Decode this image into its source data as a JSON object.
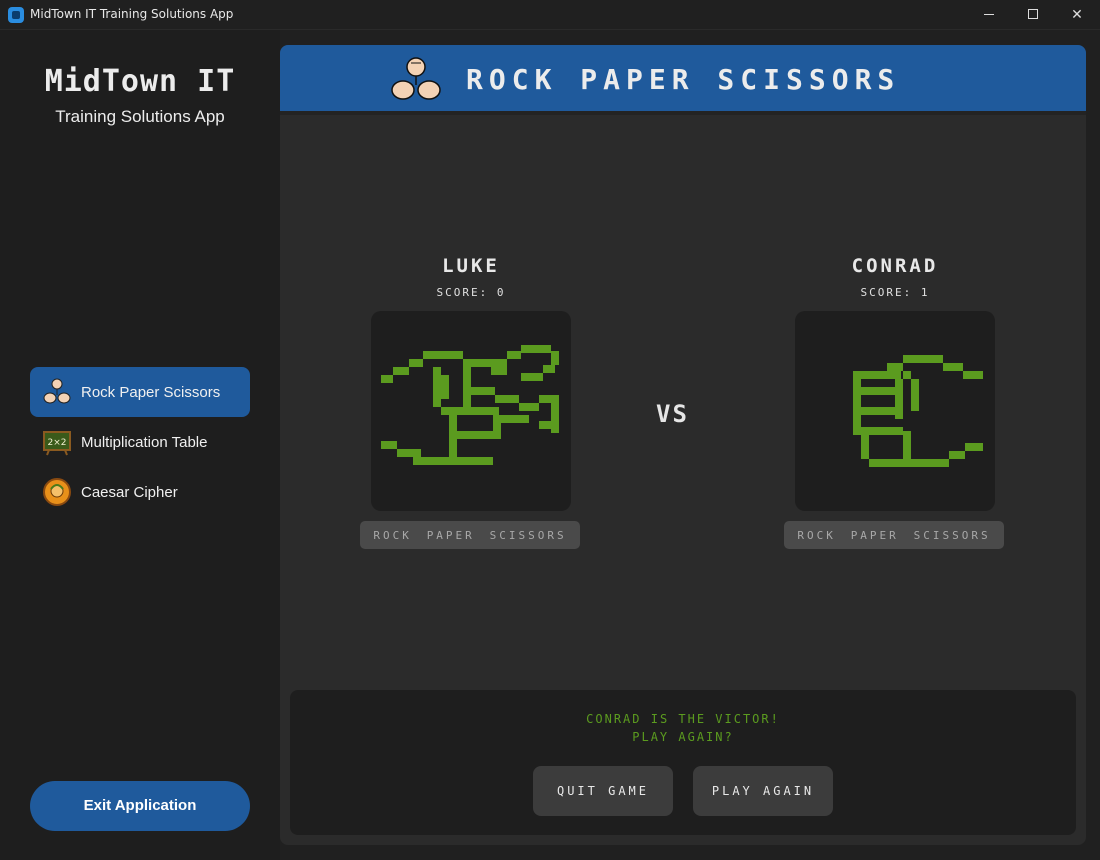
{
  "window": {
    "title": "MidTown IT Training Solutions App",
    "controls": [
      "minimize",
      "maximize",
      "close"
    ]
  },
  "sidebar": {
    "brand_title": "MidTown IT",
    "brand_subtitle": "Training Solutions App",
    "items": [
      {
        "label": "Rock Paper Scissors",
        "icon": "rps-hands-icon",
        "active": true
      },
      {
        "label": "Multiplication Table",
        "icon": "chalkboard-icon",
        "icon_text": "2×2",
        "active": false
      },
      {
        "label": "Caesar Cipher",
        "icon": "caesar-coin-icon",
        "active": false
      }
    ],
    "exit_label": "Exit Application"
  },
  "header": {
    "title": "ROCK PAPER SCISSORS",
    "icon": "rps-hands-icon"
  },
  "players": [
    {
      "name": "LUKE",
      "score_label": "SCORE:",
      "score": 0,
      "hand": "scissors",
      "choices": [
        "ROCK",
        "PAPER",
        "SCISSORS"
      ]
    },
    {
      "name": "CONRAD",
      "score_label": "SCORE:",
      "score": 1,
      "hand": "rock",
      "choices": [
        "ROCK",
        "PAPER",
        "SCISSORS"
      ]
    }
  ],
  "vs_label": "VS",
  "result": {
    "line1": "CONRAD IS THE VICTOR!",
    "line2": "PLAY AGAIN?",
    "quit_label": "QUIT GAME",
    "play_label": "PLAY AGAIN"
  },
  "colors": {
    "accent": "#1f5a9c",
    "sidebar_bg": "#1e1e1e",
    "panel_bg": "#2b2b2b",
    "pixel_green": "#5b9b1f",
    "choice_bg": "#4a4a4a"
  }
}
